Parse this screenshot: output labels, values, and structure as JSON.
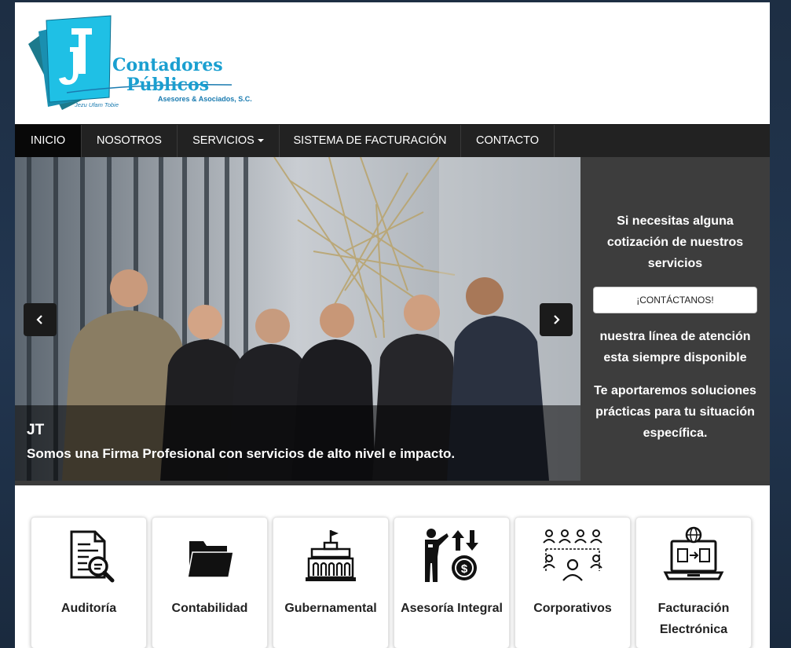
{
  "brand": {
    "monogram": "JT",
    "name_line1": "Contadores",
    "name_line2": "Públicos",
    "tagline": "Asesores & Asociados, S.C.",
    "signature": "Jezu Ufam Tobie"
  },
  "nav": {
    "items": [
      {
        "label": "INICIO",
        "active": true
      },
      {
        "label": "NOSOTROS",
        "active": false
      },
      {
        "label": "SERVICIOS",
        "active": false,
        "dropdown": true
      },
      {
        "label": "SISTEMA DE FACTURACIÓN",
        "active": false
      },
      {
        "label": "CONTACTO",
        "active": false
      }
    ]
  },
  "hero": {
    "prev_icon": "chevron-left-icon",
    "next_icon": "chevron-right-icon",
    "caption_title": "JT",
    "caption_text": "Somos una Firma Profesional con servicios de alto nivel e impacto."
  },
  "sidebar": {
    "quote_text": "Si necesitas alguna cotización de nuestros servicios",
    "button_label": "¡CONTÁCTANOS!",
    "line_text": "nuestra línea de atención esta siempre disponible",
    "solutions_text": "Te aportaremos soluciones prácticas para tu situación específica."
  },
  "services": [
    {
      "label": "Auditoría",
      "icon": "audit-document-icon"
    },
    {
      "label": "Contabilidad",
      "icon": "folder-icon"
    },
    {
      "label": "Gubernamental",
      "icon": "government-building-icon"
    },
    {
      "label": "Asesoría Integral",
      "icon": "advisor-exchange-icon"
    },
    {
      "label": "Corporativos",
      "icon": "corporate-network-icon"
    },
    {
      "label": "Facturación Electrónica",
      "icon": "e-invoice-laptop-icon"
    }
  ],
  "colors": {
    "brand_cyan": "#19bde0",
    "brand_blue": "#1a7bb0",
    "nav_bg": "#222222",
    "sidebar_bg": "#3d3d3d",
    "page_bg": "#1d2e43"
  }
}
